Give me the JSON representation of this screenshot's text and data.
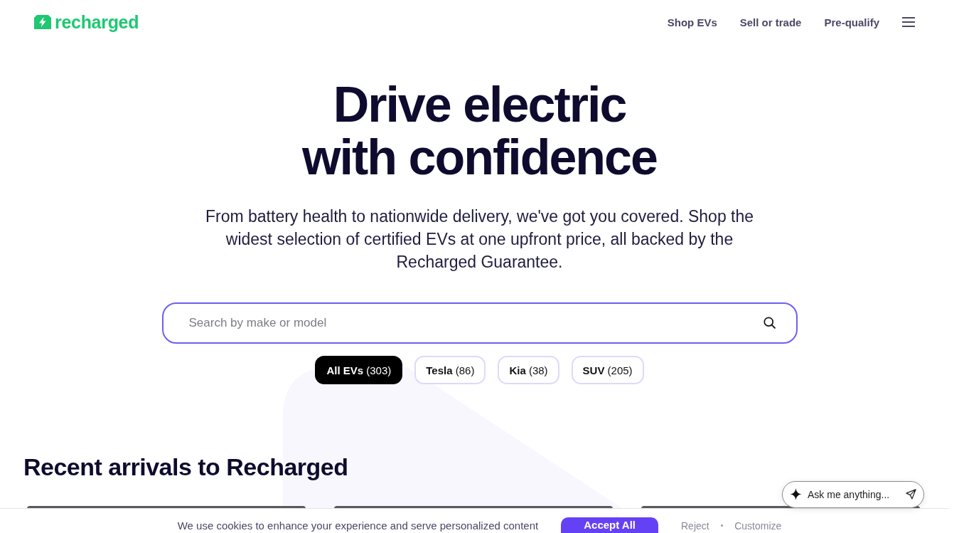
{
  "header": {
    "logo": "recharged",
    "nav": [
      {
        "label": "Shop EVs"
      },
      {
        "label": "Sell or trade"
      },
      {
        "label": "Pre-qualify"
      }
    ]
  },
  "hero": {
    "title_lines": [
      "Drive electric",
      "with confidence"
    ],
    "description": "From battery health to nationwide delivery, we've got you covered. Shop the widest selection of certified EVs at one upfront price, all backed by the Recharged Guarantee.",
    "search": {
      "placeholder": "Search by make or model"
    },
    "filters": [
      {
        "label": "**All EVs** (303)",
        "selected": true
      },
      {
        "label": "**Tesla** (86)",
        "selected": false
      },
      {
        "label": "**Kia** (38)",
        "selected": false
      },
      {
        "label": "**SUV** (205)",
        "selected": false
      }
    ]
  },
  "recent_arrivals": {
    "heading": "Recent arrivals to Recharged"
  },
  "assistant": {
    "placeholder": "Ask me anything..."
  },
  "cookie_banner": {
    "message": "We use cookies to enhance your experience and serve personalized content",
    "accept": "Accept All",
    "links": [
      "Reject",
      "Customize"
    ],
    "separator": "•"
  }
}
